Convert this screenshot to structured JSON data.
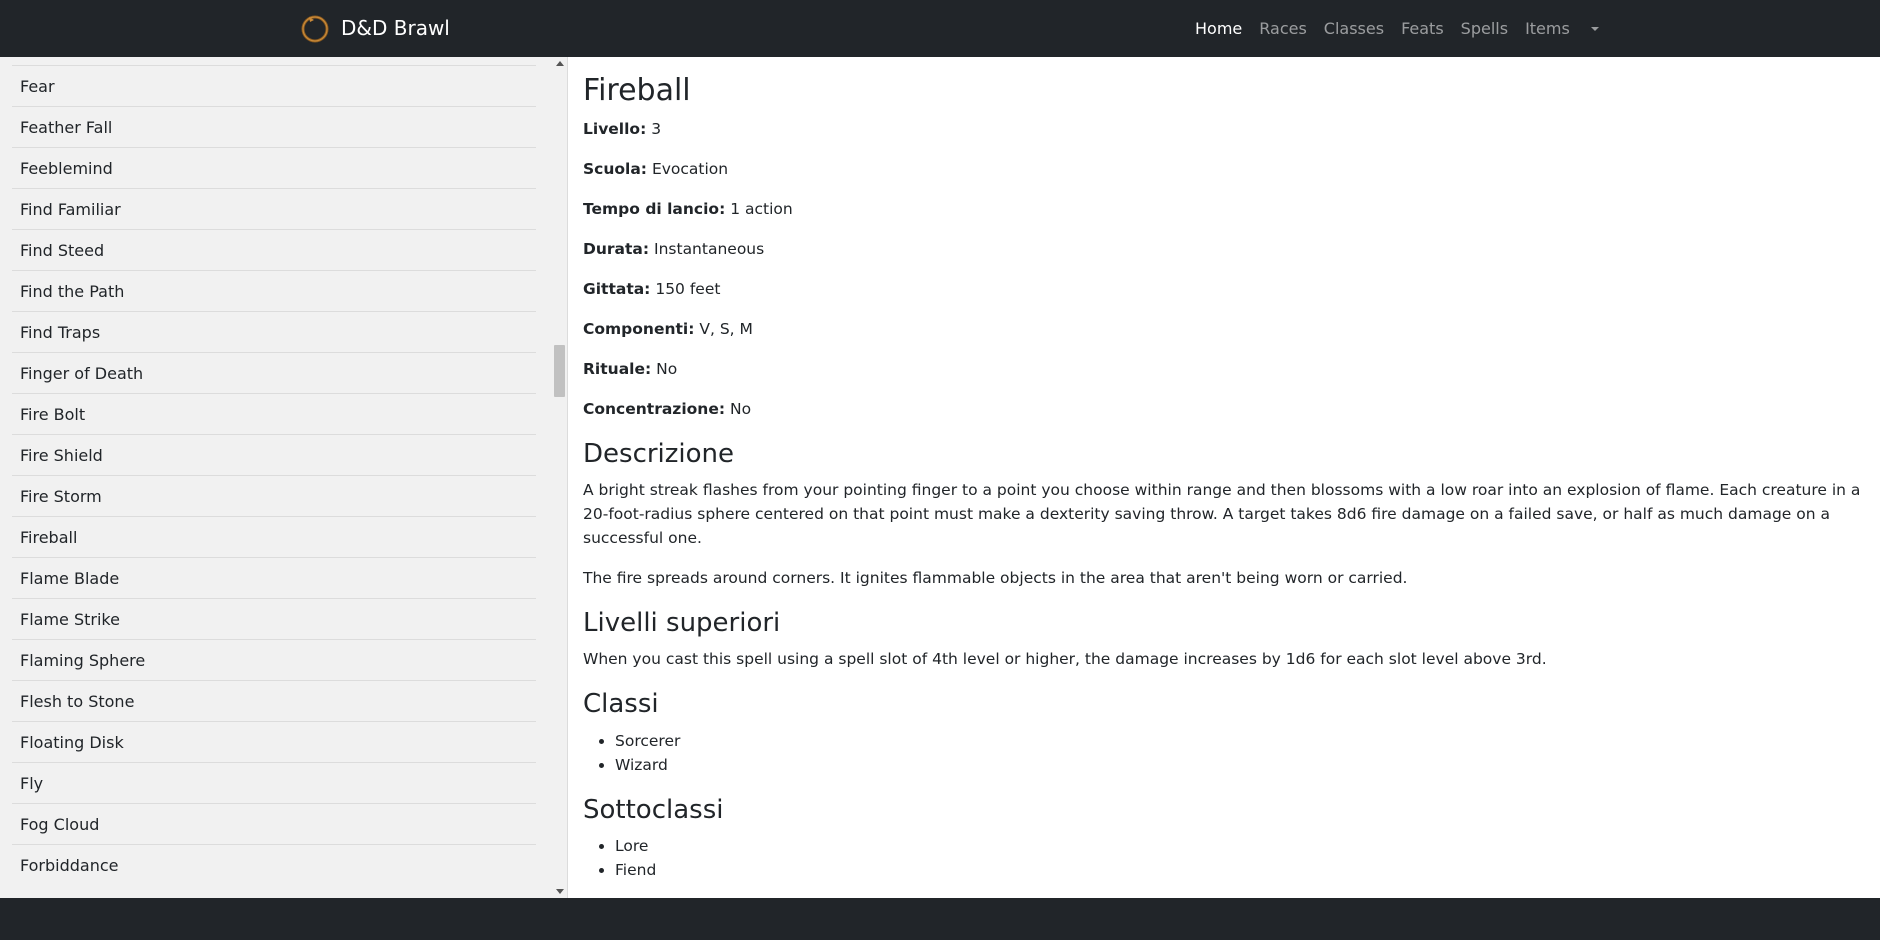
{
  "navbar": {
    "brand": "D&D Brawl",
    "links": [
      {
        "label": "Home",
        "active": true
      },
      {
        "label": "Races",
        "active": false
      },
      {
        "label": "Classes",
        "active": false
      },
      {
        "label": "Feats",
        "active": false
      },
      {
        "label": "Spells",
        "active": false
      },
      {
        "label": "Items",
        "active": false
      }
    ]
  },
  "sidebar": {
    "items": [
      "Fear",
      "Feather Fall",
      "Feeblemind",
      "Find Familiar",
      "Find Steed",
      "Find the Path",
      "Find Traps",
      "Finger of Death",
      "Fire Bolt",
      "Fire Shield",
      "Fire Storm",
      "Fireball",
      "Flame Blade",
      "Flame Strike",
      "Flaming Sphere",
      "Flesh to Stone",
      "Floating Disk",
      "Fly",
      "Fog Cloud",
      "Forbiddance"
    ]
  },
  "spell": {
    "name": "Fireball",
    "properties": [
      {
        "key": "Livello:",
        "value": "3"
      },
      {
        "key": "Scuola:",
        "value": "Evocation"
      },
      {
        "key": "Tempo di lancio:",
        "value": "1 action"
      },
      {
        "key": "Durata:",
        "value": "Instantaneous"
      },
      {
        "key": "Gittata:",
        "value": "150 feet"
      },
      {
        "key": "Componenti:",
        "value": "V, S, M"
      },
      {
        "key": "Rituale:",
        "value": "No"
      },
      {
        "key": "Concentrazione:",
        "value": "No"
      }
    ],
    "description_title": "Descrizione",
    "description": [
      "A bright streak flashes from your pointing finger to a point you choose within range and then blossoms with a low roar into an explosion of flame. Each creature in a 20-foot-radius sphere centered on that point must make a dexterity saving throw. A target takes 8d6 fire damage on a failed save, or half as much damage on a successful one.",
      "The fire spreads around corners. It ignites flammable objects in the area that aren't being worn or carried."
    ],
    "higher_title": "Livelli superiori",
    "higher_levels": "When you cast this spell using a spell slot of 4th level or higher, the damage increases by 1d6 for each slot level above 3rd.",
    "classes_title": "Classi",
    "classes": [
      "Sorcerer",
      "Wizard"
    ],
    "subclasses_title": "Sottoclassi",
    "subclasses": [
      "Lore",
      "Fiend"
    ]
  }
}
